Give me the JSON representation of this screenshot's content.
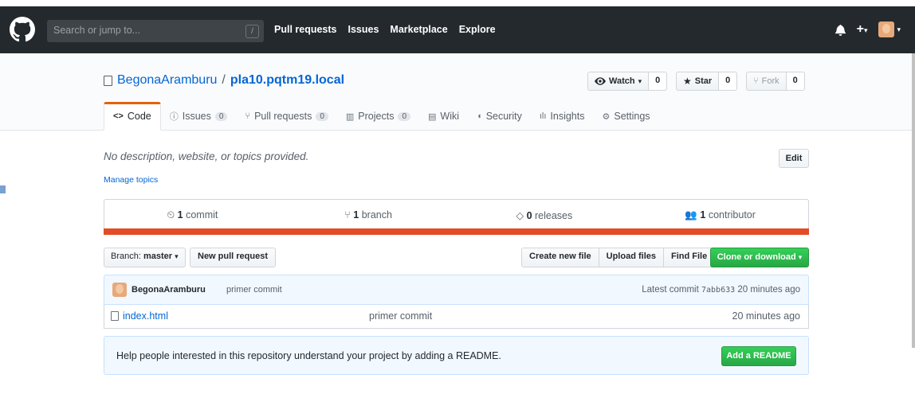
{
  "header": {
    "search_placeholder": "Search or jump to...",
    "search_shortcut": "/",
    "nav": [
      "Pull requests",
      "Issues",
      "Marketplace",
      "Explore"
    ],
    "plus": "+",
    "caret": "▾"
  },
  "repo": {
    "owner": "BegonaAramburu",
    "separator": "/",
    "name": "pla10.pqtm19.local",
    "watch": {
      "label": "Watch",
      "count": "0"
    },
    "star": {
      "label": "Star",
      "count": "0"
    },
    "fork": {
      "label": "Fork",
      "count": "0"
    }
  },
  "tabs": [
    {
      "label": "Code",
      "icon": "<>",
      "count": ""
    },
    {
      "label": "Issues",
      "icon": "ⓘ",
      "count": "0"
    },
    {
      "label": "Pull requests",
      "icon": "⑂",
      "count": "0"
    },
    {
      "label": "Projects",
      "icon": "▥",
      "count": "0"
    },
    {
      "label": "Wiki",
      "icon": "▤",
      "count": ""
    },
    {
      "label": "Security",
      "icon": "◖",
      "count": ""
    },
    {
      "label": "Insights",
      "icon": "ılı",
      "count": ""
    },
    {
      "label": "Settings",
      "icon": "⚙",
      "count": ""
    }
  ],
  "description": "No description, website, or topics provided.",
  "manage_topics": "Manage topics",
  "edit": "Edit",
  "summary": {
    "commits": {
      "num": "1",
      "label": "commit"
    },
    "branches": {
      "num": "1",
      "label": "branch"
    },
    "releases": {
      "num": "0",
      "label": "releases"
    },
    "contributors": {
      "num": "1",
      "label": "contributor"
    }
  },
  "language_color": "#e34c26",
  "file_nav": {
    "branch_prefix": "Branch:",
    "branch": "master",
    "new_pull_request": "New pull request",
    "create_new_file": "Create new file",
    "upload_files": "Upload files",
    "find_file": "Find File",
    "clone": "Clone or download"
  },
  "latest_commit": {
    "author": "BegonaAramburu",
    "message": "primer commit",
    "prefix": "Latest commit",
    "sha": "7abb633",
    "age": "20 minutes ago"
  },
  "files": [
    {
      "name": "index.html",
      "message": "primer commit",
      "age": "20 minutes ago"
    }
  ],
  "readme_prompt": {
    "text": "Help people interested in this repository understand your project by adding a README.",
    "button": "Add a README"
  }
}
